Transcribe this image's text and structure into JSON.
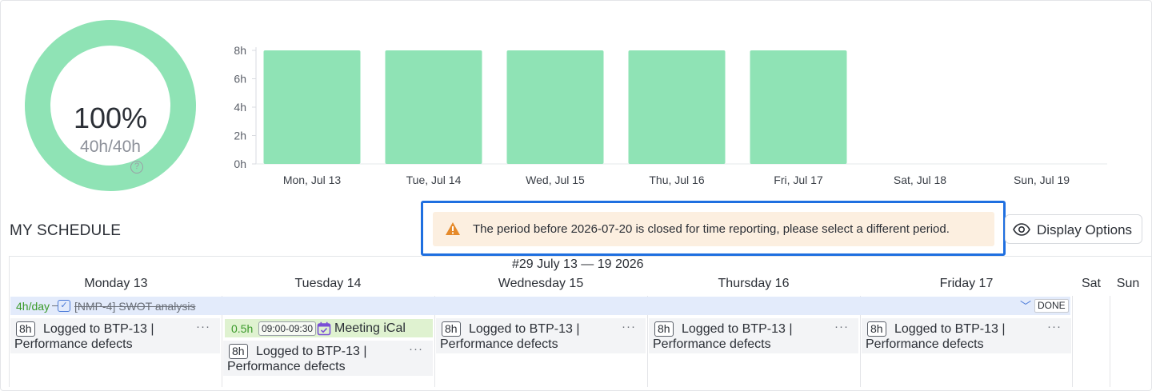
{
  "summary": {
    "percent": "100%",
    "hours": "40h/40h",
    "help_icon": "question-circle-icon",
    "accent_color": "#8fe3b5"
  },
  "chart_data": {
    "type": "bar",
    "categories": [
      "Mon, Jul 13",
      "Tue, Jul 14",
      "Wed, Jul 15",
      "Thu, Jul 16",
      "Fri, Jul 17",
      "Sat, Jul 18",
      "Sun, Jul 19"
    ],
    "values": [
      8,
      8,
      8,
      8,
      8,
      0,
      0
    ],
    "ylim": [
      0,
      8
    ],
    "yticks": [
      "0h",
      "2h",
      "4h",
      "6h",
      "8h"
    ],
    "ytick_values": [
      0,
      2,
      4,
      6,
      8
    ],
    "bar_color": "#8fe3b5",
    "grid": true
  },
  "schedule": {
    "title": "MY SCHEDULE",
    "alert": {
      "icon": "warning-icon",
      "text": "The period before 2026-07-20 is closed for time reporting, please select a different period."
    },
    "display_options": {
      "icon": "eye-icon",
      "label": "Display Options"
    },
    "week_label": "#29 July 13 — 19 2026",
    "days": [
      "Monday 13",
      "Tuesday 14",
      "Wednesday 15",
      "Thursday 16",
      "Friday 17",
      "Sat",
      "Sun"
    ],
    "task": {
      "rate": "4h/day",
      "name": "[NMP-4] SWOT analysis",
      "status": "DONE",
      "color": "#e3ebfb"
    },
    "meeting": {
      "hours": "0.5h",
      "time": "09:00-09:30",
      "label": "Meeting iCal",
      "icon": "calendar-check-icon"
    },
    "entries": [
      {
        "hours": "8h",
        "line1": "Logged to BTP-13 |",
        "line2": "Performance defects",
        "more": "···"
      },
      {
        "hours": "8h",
        "line1": "Logged to BTP-13 |",
        "line2": "Performance defects",
        "more": "···"
      },
      {
        "hours": "8h",
        "line1": "Logged to BTP-13 |",
        "line2": "Performance defects",
        "more": "···"
      },
      {
        "hours": "8h",
        "line1": "Logged to BTP-13 |",
        "line2": "Performance defects",
        "more": "···"
      },
      {
        "hours": "8h",
        "line1": "Logged to BTP-13 |",
        "line2": "Performance defects",
        "more": "···"
      }
    ]
  }
}
